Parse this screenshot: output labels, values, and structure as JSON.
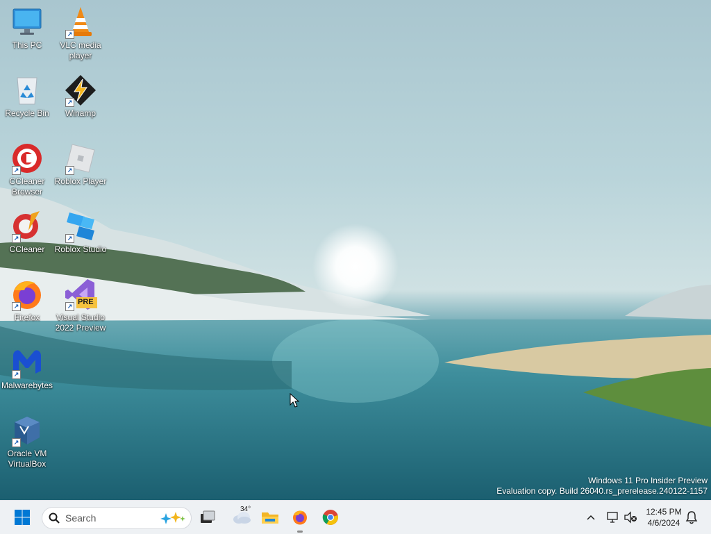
{
  "desktop": {
    "icons": [
      {
        "label": "This PC"
      },
      {
        "label": "VLC media player"
      },
      {
        "label": "Recycle Bin"
      },
      {
        "label": "Winamp"
      },
      {
        "label": "CCleaner Browser"
      },
      {
        "label": "Roblox Player"
      },
      {
        "label": "CCleaner"
      },
      {
        "label": "Roblox Studio"
      },
      {
        "label": "Firefox"
      },
      {
        "label": "Visual Studio 2022 Preview"
      },
      {
        "label": "Malwarebytes"
      },
      {
        "label": "Oracle VM VirtualBox"
      }
    ],
    "vs_badge": "PRE",
    "watermark": {
      "line1": "Windows 11 Pro Insider Preview",
      "line2": "Evaluation copy. Build 26040.rs_prerelease.240122-1157"
    }
  },
  "taskbar": {
    "search_placeholder": "Search",
    "weather_temp": "34°",
    "clock_time": "12:45 PM",
    "clock_date": "4/6/2024",
    "accent": "#0078d4"
  }
}
